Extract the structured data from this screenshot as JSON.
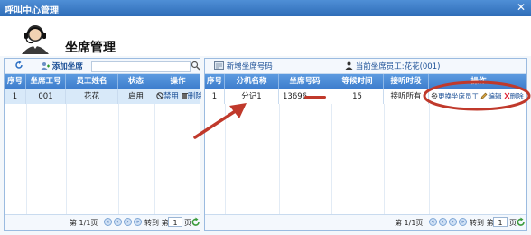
{
  "window": {
    "title": "呼叫中心管理",
    "close": "✕"
  },
  "header": {
    "title": "坐席管理"
  },
  "left": {
    "add_label": "添加坐席",
    "search": {
      "value": ""
    },
    "columns": [
      "序号",
      "坐席工号",
      "员工姓名",
      "状态",
      "操作"
    ],
    "rows": [
      {
        "index": "1",
        "id": "001",
        "name": "花花",
        "status": "启用",
        "disable": "禁用",
        "delete": "删除"
      }
    ],
    "pager": {
      "page_info": "第 1/1页",
      "goto_label": "转到 第",
      "page_value": "1",
      "page_suffix": "页"
    }
  },
  "right": {
    "add_label": "新增坐席号码",
    "current_label": "当前坐席员工:花花(001)",
    "columns": [
      "序号",
      "分机名称",
      "坐席号码",
      "等候时间",
      "接听时段",
      "操作"
    ],
    "rows": [
      {
        "index": "1",
        "ext_name": "分记1",
        "number": "13696",
        "wait": "15",
        "period": "接听所有",
        "change": "更换坐席员工",
        "edit": "编辑",
        "delete": "删除"
      }
    ],
    "pager": {
      "page_info": "第 1/1页",
      "goto_label": "转到 第",
      "page_value": "1",
      "page_suffix": "页"
    }
  },
  "colors": {
    "annotation": "#c0392b",
    "accent": "#3c7ccc"
  }
}
